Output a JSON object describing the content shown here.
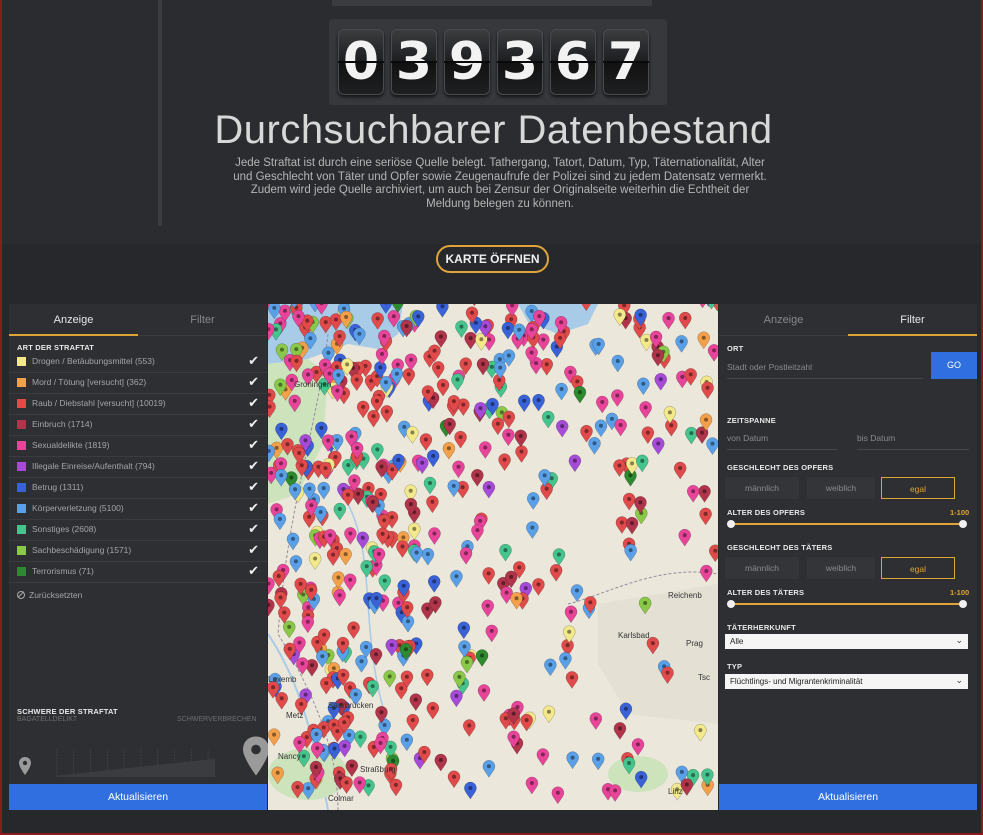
{
  "counter": {
    "digits": [
      "0",
      "3",
      "9",
      "3",
      "6",
      "7"
    ]
  },
  "hero": {
    "title": "Durchsuchbarer Datenbestand",
    "description": "Jede Straftat ist durch eine seriöse Quelle belegt. Tathergang, Tatort, Datum, Typ, Täternationalität, Alter und Geschlecht von Täter und Opfer sowie Zeugenaufrufe der Polizei sind zu jedem Datensatz vermerkt. Zudem wird jede Quelle archiviert, um auch bei Zensur der Originalseite weiterhin die Echtheit der Meldung belegen zu können."
  },
  "karte_button": "KARTE ÖFFNEN",
  "left_panel": {
    "tabs": [
      "Anzeige",
      "Filter"
    ],
    "active_tab": 0,
    "section_title": "ART DER STRAFTAT",
    "crimes": [
      {
        "label": "Drogen / Betäubungsmittel (553)",
        "color": "#f3e98a",
        "checked": true
      },
      {
        "label": "Mord / Tötung [versucht] (362)",
        "color": "#f4a04a",
        "checked": true
      },
      {
        "label": "Raub / Diebstahl [versucht] (10019)",
        "color": "#e04a4a",
        "checked": true
      },
      {
        "label": "Einbruch (1714)",
        "color": "#b0344a",
        "checked": true
      },
      {
        "label": "Sexualdelikte (1819)",
        "color": "#e8459a",
        "checked": true
      },
      {
        "label": "Illegale Einreise/Aufenthalt (794)",
        "color": "#a64ad8",
        "checked": true
      },
      {
        "label": "Betrug (1311)",
        "color": "#3a62d8",
        "checked": true
      },
      {
        "label": "Körperverletzung (5100)",
        "color": "#5aa0e8",
        "checked": true
      },
      {
        "label": "Sonstiges (2608)",
        "color": "#45c48e",
        "checked": true
      },
      {
        "label": "Sachbeschädigung (1571)",
        "color": "#8ac848",
        "checked": true
      },
      {
        "label": "Terrorismus (71)",
        "color": "#2e8a2e",
        "checked": true
      }
    ],
    "reset_label": "Zurücksetzten",
    "severity_title": "SCHWERE DER STRAFTAT",
    "severity_min": "BAGATELLDELIKT",
    "severity_max": "SCHWERVERBRECHEN",
    "update_button": "Aktualisieren"
  },
  "right_panel": {
    "tabs": [
      "Anzeige",
      "Filter"
    ],
    "active_tab": 1,
    "ort_label": "ORT",
    "ort_placeholder": "Stadt oder Postleitzahl",
    "go_button": "GO",
    "zeitspanne_label": "ZEITSPANNE",
    "von_placeholder": "von Datum",
    "bis_placeholder": "bis Datum",
    "opfer_gender_label": "GESCHLECHT DES OPFERS",
    "gender_options": [
      "männlich",
      "weiblich",
      "egal"
    ],
    "opfer_gender_selected": 2,
    "opfer_age_label": "ALTER DES OPFERS",
    "opfer_age_value": "1-100",
    "taeter_gender_label": "GESCHLECHT DES TÄTERS",
    "taeter_gender_selected": 2,
    "taeter_age_label": "ALTER DES TÄTERS",
    "taeter_age_value": "1-100",
    "herkunft_label": "TÄTERHERKUNFT",
    "herkunft_value": "Alle",
    "typ_label": "TYP",
    "typ_value": "Flüchtlings- und Migrantenkriminalität",
    "update_button": "Aktualisieren"
  },
  "map": {
    "cities": [
      "Groningen",
      "Prag",
      "Karlsbad",
      "Luxemb",
      "Metz",
      "Nancy",
      "Saarbrücken",
      "Straßburg",
      "Colmar",
      "Tsc",
      "Reichenb",
      "Linz"
    ]
  }
}
